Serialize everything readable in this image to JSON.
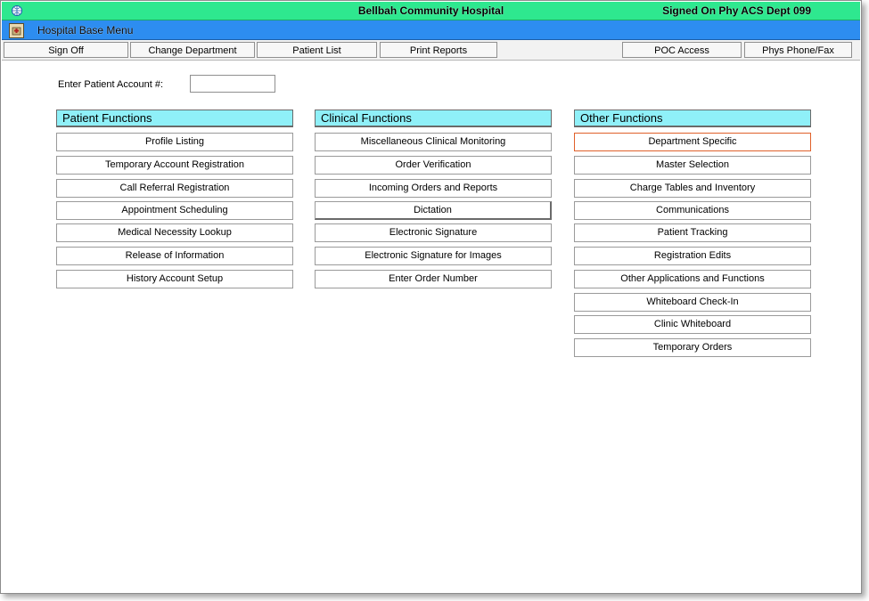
{
  "titlebar": {
    "icon": "app-globe-icon",
    "title": "Bellbah Community Hospital",
    "right": "Signed On Phy ACS  Dept 099"
  },
  "menubar": {
    "icon": "hospital-icon",
    "title": "Hospital Base Menu"
  },
  "toolbar": {
    "sign_off": "Sign Off",
    "change_department": "Change Department",
    "patient_list": "Patient List",
    "print_reports": "Print Reports",
    "poc_access": "POC Access",
    "phys_phone_fax": "Phys Phone/Fax"
  },
  "account": {
    "label": "Enter Patient Account #:",
    "value": ""
  },
  "patient_functions": {
    "title": "Patient Functions",
    "items": [
      "Profile Listing",
      "Temporary Account Registration",
      "Call Referral Registration",
      "Appointment Scheduling",
      "Medical Necessity Lookup",
      "Release of Information",
      "History Account Setup"
    ]
  },
  "clinical_functions": {
    "title": "Clinical Functions",
    "items": [
      "Miscellaneous Clinical Monitoring",
      "Order Verification",
      "Incoming Orders and Reports",
      "Dictation",
      "Electronic Signature",
      "Electronic Signature for Images",
      "Enter Order Number"
    ]
  },
  "other_functions": {
    "title": "Other Functions",
    "items": [
      "Department Specific",
      "Master Selection",
      "Charge Tables and Inventory",
      "Communications",
      "Patient Tracking",
      "Registration Edits",
      "Other Applications and Functions",
      "Whiteboard Check-In",
      "Clinic Whiteboard",
      "Temporary Orders"
    ]
  },
  "colors": {
    "titlebar": "#2ee88f",
    "menubar": "#2d8df0",
    "panel_header": "#8ff0f8",
    "focus_border": "#e0602a"
  }
}
